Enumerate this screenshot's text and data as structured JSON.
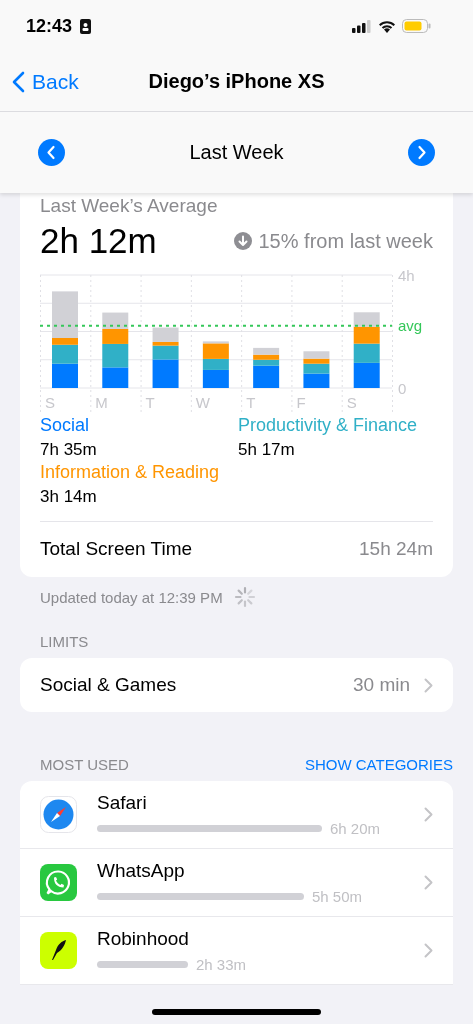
{
  "status_bar": {
    "time": "12:43"
  },
  "nav": {
    "back": "Back",
    "title": "Diego’s iPhone XS"
  },
  "period": {
    "label": "Last Week"
  },
  "summary": {
    "title": "Last Week’s Average",
    "value": "2h 12m",
    "change": "15% from last week",
    "chart_data": {
      "type": "bar",
      "stacked": true,
      "categories": [
        "S",
        "M",
        "T",
        "W",
        "T",
        "F",
        "S"
      ],
      "ylim": [
        0,
        4
      ],
      "yticks": [
        {
          "value": 0,
          "label": "0"
        },
        {
          "value": 4,
          "label": "4h"
        }
      ],
      "series": [
        {
          "name": "Social",
          "color": "#007aff",
          "values": [
            0.86,
            0.73,
            1.01,
            0.64,
            0.79,
            0.51,
            0.89
          ]
        },
        {
          "name": "Productivity & Finance",
          "color": "#30b0c7",
          "values": [
            0.67,
            0.83,
            0.49,
            0.39,
            0.21,
            0.35,
            0.68
          ]
        },
        {
          "name": "Information & Reading",
          "color": "#ff9500",
          "values": [
            0.24,
            0.53,
            0.13,
            0.55,
            0.18,
            0.18,
            0.6
          ]
        },
        {
          "color": "#d1d1d6",
          "values": [
            1.65,
            0.58,
            0.51,
            0.07,
            0.24,
            0.26,
            0.51
          ]
        }
      ],
      "ref_lines": [
        {
          "axis": "y",
          "value": 2.2,
          "label": "avg",
          "color": "#34c759"
        }
      ]
    },
    "legend": [
      {
        "time": "7h 35m"
      },
      {
        "time": "5h 17m"
      },
      {
        "time": "3h 14m"
      }
    ],
    "total": {
      "label": "Total Screen Time",
      "value": "15h 24m"
    }
  },
  "updated": "Updated today at 12:39 PM",
  "limits": {
    "header": "LIMITS",
    "items": [
      {
        "name": "Social & Games",
        "value": "30 min"
      }
    ]
  },
  "most_used": {
    "header": "MOST USED",
    "action": "SHOW CATEGORIES",
    "apps": [
      {
        "name": "Safari",
        "time": "6h 20m"
      },
      {
        "name": "WhatsApp",
        "time": "5h 50m"
      },
      {
        "name": "Robinhood",
        "time": "2h 33m"
      }
    ]
  }
}
